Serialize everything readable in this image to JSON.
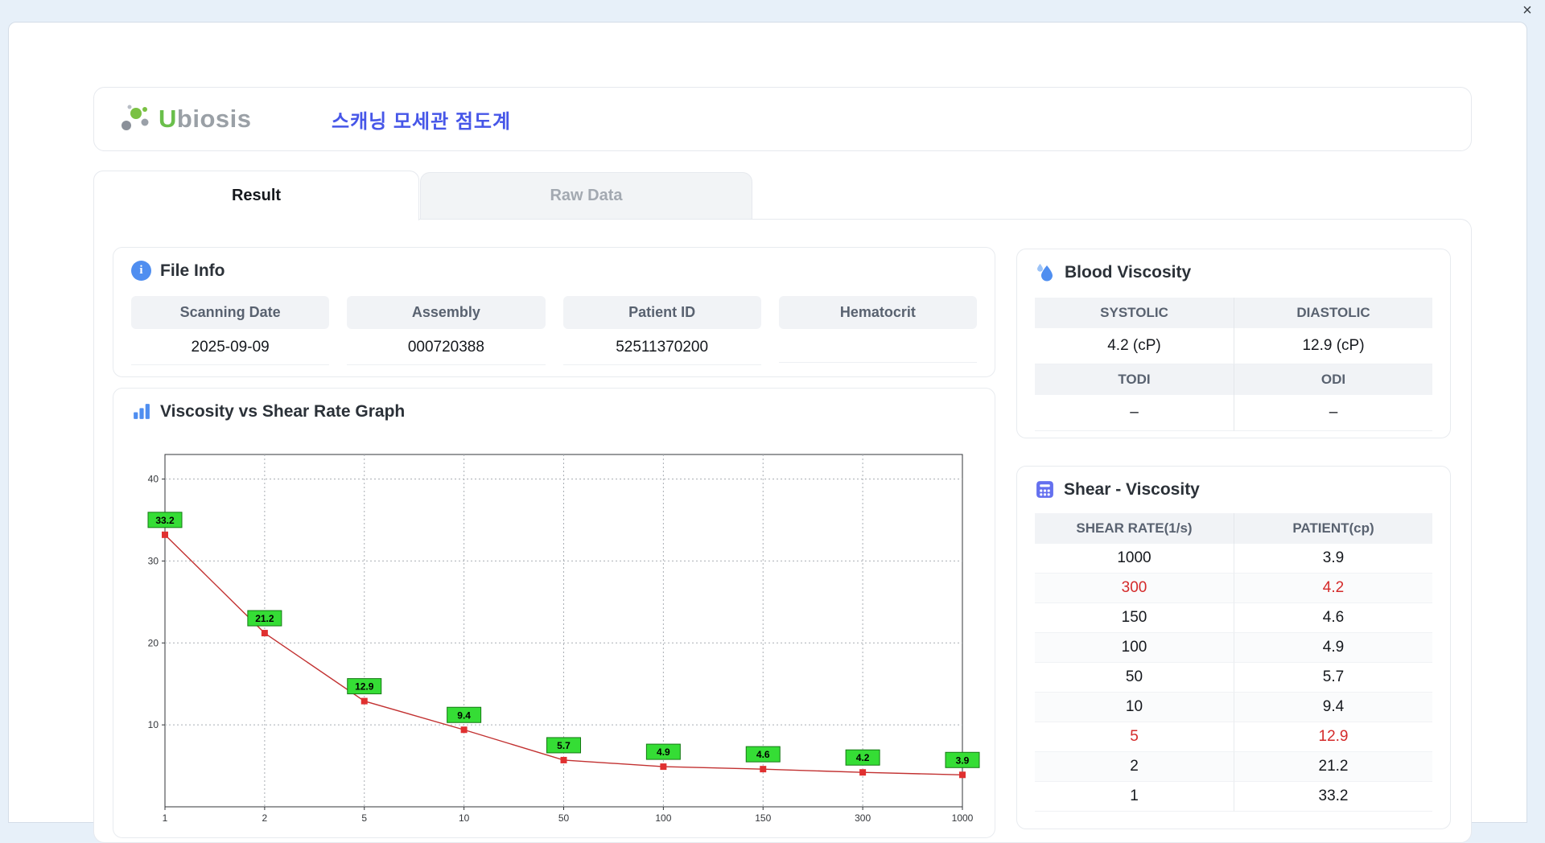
{
  "window": {
    "close_glyph": "×"
  },
  "header": {
    "logo_u": "U",
    "logo_rest": "biosis",
    "title": "스캐닝 모세관 점도계"
  },
  "tabs": [
    {
      "label": "Result",
      "active": true
    },
    {
      "label": "Raw Data",
      "active": false
    }
  ],
  "file_info": {
    "title": "File Info",
    "info_glyph": "i",
    "fields": [
      {
        "label": "Scanning Date",
        "value": "2025-09-09"
      },
      {
        "label": "Assembly",
        "value": "000720388"
      },
      {
        "label": "Patient ID",
        "value": "52511370200"
      },
      {
        "label": "Hematocrit",
        "value": ""
      }
    ]
  },
  "graph": {
    "title": "Viscosity vs Shear Rate Graph"
  },
  "chart_data": {
    "type": "line",
    "title": "Viscosity vs Shear Rate Graph",
    "x_scale": "categorical",
    "categories": [
      "1",
      "2",
      "5",
      "10",
      "50",
      "100",
      "150",
      "300",
      "1000"
    ],
    "series": [
      {
        "name": "Patient",
        "values": [
          33.2,
          21.2,
          12.9,
          9.4,
          5.7,
          4.9,
          4.6,
          4.2,
          3.9
        ]
      }
    ],
    "xlabel": "",
    "ylabel": "",
    "ylim": [
      0,
      43
    ],
    "y_ticks": [
      10,
      20,
      30,
      40
    ],
    "grid": true,
    "legend": false,
    "line_color": "#c23131",
    "marker": "square",
    "marker_color": "#e03030",
    "point_label_bg": "#35dd35",
    "point_label_border": "#157915",
    "point_label_text": "#000000"
  },
  "blood_viscosity": {
    "title": "Blood Viscosity",
    "pairs": [
      {
        "headers": [
          "SYSTOLIC",
          "DIASTOLIC"
        ],
        "values": [
          "4.2 (cP)",
          "12.9 (cP)"
        ]
      },
      {
        "headers": [
          "TODI",
          "ODI"
        ],
        "values": [
          "–",
          "–"
        ]
      }
    ]
  },
  "shear_viscosity": {
    "title": "Shear - Viscosity",
    "headers": [
      "SHEAR RATE(1/s)",
      "PATIENT(cp)"
    ],
    "rows": [
      {
        "shear_rate": "1000",
        "patient": "3.9",
        "highlight": false
      },
      {
        "shear_rate": "300",
        "patient": "4.2",
        "highlight": true
      },
      {
        "shear_rate": "150",
        "patient": "4.6",
        "highlight": false
      },
      {
        "shear_rate": "100",
        "patient": "4.9",
        "highlight": false
      },
      {
        "shear_rate": "50",
        "patient": "5.7",
        "highlight": false
      },
      {
        "shear_rate": "10",
        "patient": "9.4",
        "highlight": false
      },
      {
        "shear_rate": "5",
        "patient": "12.9",
        "highlight": true
      },
      {
        "shear_rate": "2",
        "patient": "21.2",
        "highlight": false
      },
      {
        "shear_rate": "1",
        "patient": "33.2",
        "highlight": false
      }
    ]
  },
  "colors": {
    "accent_title": "#4656e8",
    "highlight_red": "#d42a2a",
    "icon_blue": "#4f8ef0",
    "icon_purple": "#6470ef",
    "logo_green": "#6abf4b"
  }
}
